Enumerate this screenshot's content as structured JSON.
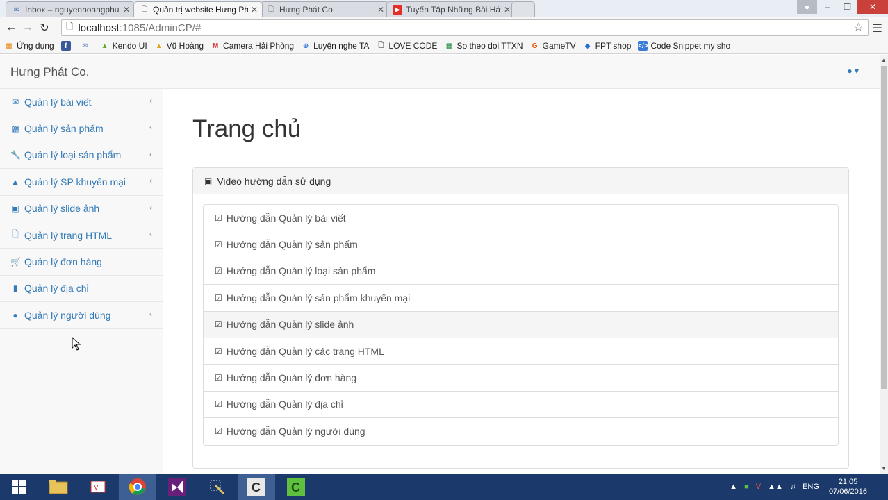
{
  "browser": {
    "tabs": [
      {
        "title": "Inbox – nguyenhoangphu",
        "icon": "mail-icon",
        "active": false
      },
      {
        "title": "Quản trị website Hưng Ph",
        "icon": "page-icon",
        "active": true
      },
      {
        "title": "Hưng Phát Co.",
        "icon": "page-icon",
        "active": false
      },
      {
        "title": "Tuyển Tập Những Bài Hát",
        "icon": "youtube-icon",
        "active": false
      }
    ],
    "url_host": "localhost",
    "url_path": ":1085/AdminCP/#",
    "bookmarks": [
      {
        "label": "Ứng dụng",
        "icon": "apps-icon"
      },
      {
        "label": "",
        "icon": "facebook-icon"
      },
      {
        "label": "",
        "icon": "mail-icon"
      },
      {
        "label": "Kendo UI",
        "icon": "kendo-icon"
      },
      {
        "label": "Vũ Hoàng",
        "icon": "image-icon"
      },
      {
        "label": "Camera Hải Phòng",
        "icon": "m-icon"
      },
      {
        "label": "Luyện nghe TA",
        "icon": "globe-icon"
      },
      {
        "label": "LOVE CODE",
        "icon": "page-icon"
      },
      {
        "label": "So theo doi TTXN",
        "icon": "sheet-icon"
      },
      {
        "label": "GameTV",
        "icon": "g-icon"
      },
      {
        "label": "FPT shop",
        "icon": "fpt-icon"
      },
      {
        "label": "Code Snippet my sho",
        "icon": "code-icon"
      }
    ]
  },
  "site": {
    "brand": "Hưng Phát Co.",
    "sidebar": [
      {
        "label": "Quản lý bài viết",
        "icon": "envelope-icon",
        "has_children": true
      },
      {
        "label": "Quản lý sản phẩm",
        "icon": "bar-chart-icon",
        "has_children": true
      },
      {
        "label": "Quản lý loại sản phẩm",
        "icon": "wrench-icon",
        "has_children": true
      },
      {
        "label": "Quản lý SP khuyến mại",
        "icon": "sitemap-icon",
        "has_children": true
      },
      {
        "label": "Quản lý slide ảnh",
        "icon": "picture-icon",
        "has_children": true
      },
      {
        "label": "Quản lý trang HTML",
        "icon": "file-icon",
        "has_children": true
      },
      {
        "label": "Quản lý đơn hàng",
        "icon": "cart-icon",
        "has_children": false
      },
      {
        "label": "Quản lý địa chỉ",
        "icon": "book-icon",
        "has_children": false
      },
      {
        "label": "Quản lý người dùng",
        "icon": "user-icon",
        "has_children": true
      }
    ],
    "page_title": "Trang chủ",
    "panel": {
      "title": "Video hướng dẫn sử dụng",
      "items": [
        "Hướng dẫn Quản lý bài viết",
        "Hướng dẫn Quản lý sản phẩm",
        "Hướng dẫn Quản lý loại sản phẩm",
        "Hướng dẫn Quản lý sản phẩm khuyến mại",
        "Hướng dẫn Quản lý slide ảnh",
        "Hướng dẫn Quản lý các trang HTML",
        "Hướng dẫn Quản lý đơn hàng",
        "Hướng dẫn Quản lý địa chỉ",
        "Hướng dẫn Quản lý người dùng"
      ]
    }
  },
  "taskbar": {
    "language": "ENG",
    "time": "21:05",
    "date": "07/06/2016"
  }
}
